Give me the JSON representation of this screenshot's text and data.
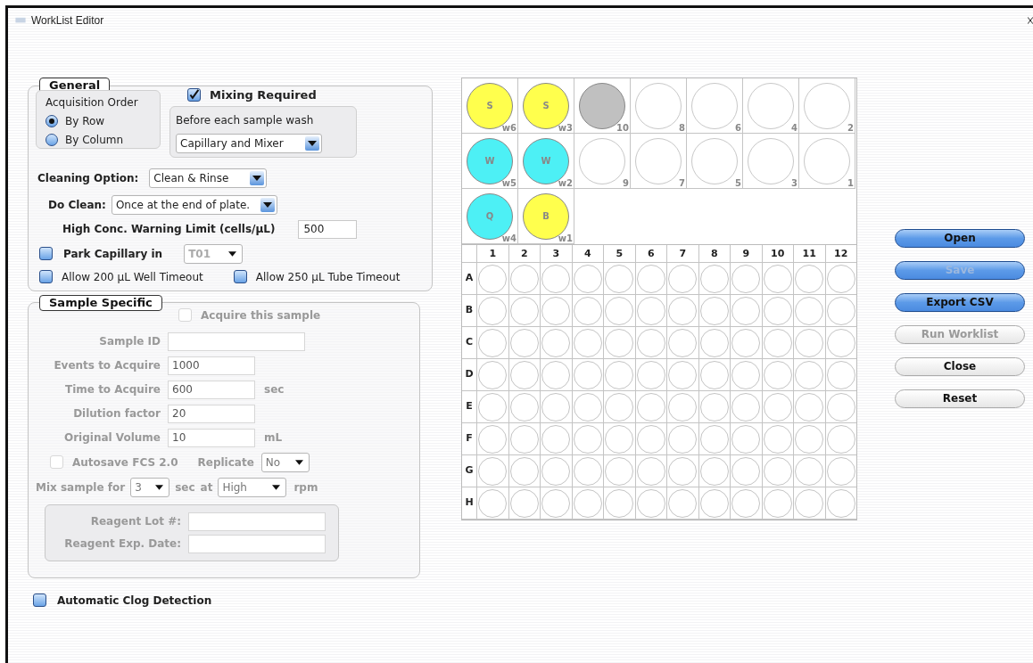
{
  "window": {
    "title": "WorkList Editor"
  },
  "general": {
    "legend": "General",
    "acquisition_order": {
      "label": "Acquisition Order",
      "options": [
        {
          "label": "By Row",
          "selected": true
        },
        {
          "label": "By Column",
          "selected": false
        }
      ]
    },
    "mixing": {
      "label": "Mixing Required",
      "checked": true,
      "wash_label": "Before each sample wash",
      "wash_value": "Capillary and Mixer"
    },
    "cleaning_option": {
      "label": "Cleaning Option:",
      "value": "Clean & Rinse"
    },
    "do_clean": {
      "label": "Do Clean:",
      "value": "Once at the end of plate."
    },
    "warning_limit": {
      "label": "High Conc. Warning Limit (cells/µL)",
      "value": "500"
    },
    "park_capillary": {
      "label": "Park Capillary in",
      "checked": false,
      "value": "T01",
      "disabled": true
    },
    "timeouts": [
      {
        "label": "Allow 200 µL Well Timeout",
        "checked": false
      },
      {
        "label": "Allow 250 µL Tube Timeout",
        "checked": false
      }
    ]
  },
  "sample_specific": {
    "legend": "Sample Specific",
    "disabled": true,
    "acquire": {
      "label": "Acquire this sample",
      "checked": false
    },
    "fields": [
      {
        "label": "Sample ID",
        "wide": true
      },
      {
        "label": "Events to Acquire",
        "value": "1000"
      },
      {
        "label": "Time to Acquire",
        "value": "600",
        "unit": "sec"
      },
      {
        "label": "Dilution factor",
        "value": "20"
      },
      {
        "label": "Original Volume",
        "value": "10",
        "unit": "mL"
      }
    ],
    "autosave": {
      "label": "Autosave FCS 2.0",
      "checked": false
    },
    "replicate": {
      "label": "Replicate",
      "value": "No"
    },
    "mix": {
      "label": "Mix sample for",
      "seconds": "3",
      "sec_label": "sec",
      "at_label": "at",
      "speed": "High",
      "unit": "rpm"
    },
    "reagent_fields": [
      {
        "label": "Reagent Lot #:"
      },
      {
        "label": "Reagent Exp. Date:"
      }
    ]
  },
  "clog_detection": {
    "label": "Automatic Clog Detection",
    "checked": false
  },
  "tube_rack": {
    "rows": [
      [
        {
          "label": "S",
          "number": "w6",
          "color": "#ffff4d"
        },
        {
          "label": "S",
          "number": "w3",
          "color": "#ffff4d"
        },
        {
          "number": "10",
          "color": "#c0c0c0"
        },
        {
          "number": "8",
          "color": "#ffffff"
        },
        {
          "number": "6",
          "color": "#ffffff"
        },
        {
          "number": "4",
          "color": "#ffffff"
        },
        {
          "number": "2",
          "color": "#ffffff"
        }
      ],
      [
        {
          "label": "W",
          "number": "w5",
          "color": "#4df0f5"
        },
        {
          "label": "W",
          "number": "w2",
          "color": "#4df0f5"
        },
        {
          "number": "9",
          "color": "#ffffff"
        },
        {
          "number": "7",
          "color": "#ffffff"
        },
        {
          "number": "5",
          "color": "#ffffff"
        },
        {
          "number": "3",
          "color": "#ffffff"
        },
        {
          "number": "1",
          "color": "#ffffff"
        }
      ],
      [
        {
          "label": "Q",
          "number": "w4",
          "color": "#4df0f5"
        },
        {
          "label": "B",
          "number": "w1",
          "color": "#ffff4d"
        }
      ]
    ]
  },
  "plate": {
    "columns": [
      "1",
      "2",
      "3",
      "4",
      "5",
      "6",
      "7",
      "8",
      "9",
      "10",
      "11",
      "12"
    ],
    "rows": [
      "A",
      "B",
      "C",
      "D",
      "E",
      "F",
      "G",
      "H"
    ]
  },
  "buttons": [
    {
      "label": "Open",
      "kind": "blue",
      "disabled": false
    },
    {
      "label": "Save",
      "kind": "blue",
      "disabled": true
    },
    {
      "label": "Export CSV",
      "kind": "blue",
      "disabled": false
    },
    {
      "label": "Run Worklist",
      "kind": "plain",
      "disabled": true
    },
    {
      "label": "Close",
      "kind": "plain",
      "disabled": false
    },
    {
      "label": "Reset",
      "kind": "plain",
      "disabled": false
    }
  ]
}
